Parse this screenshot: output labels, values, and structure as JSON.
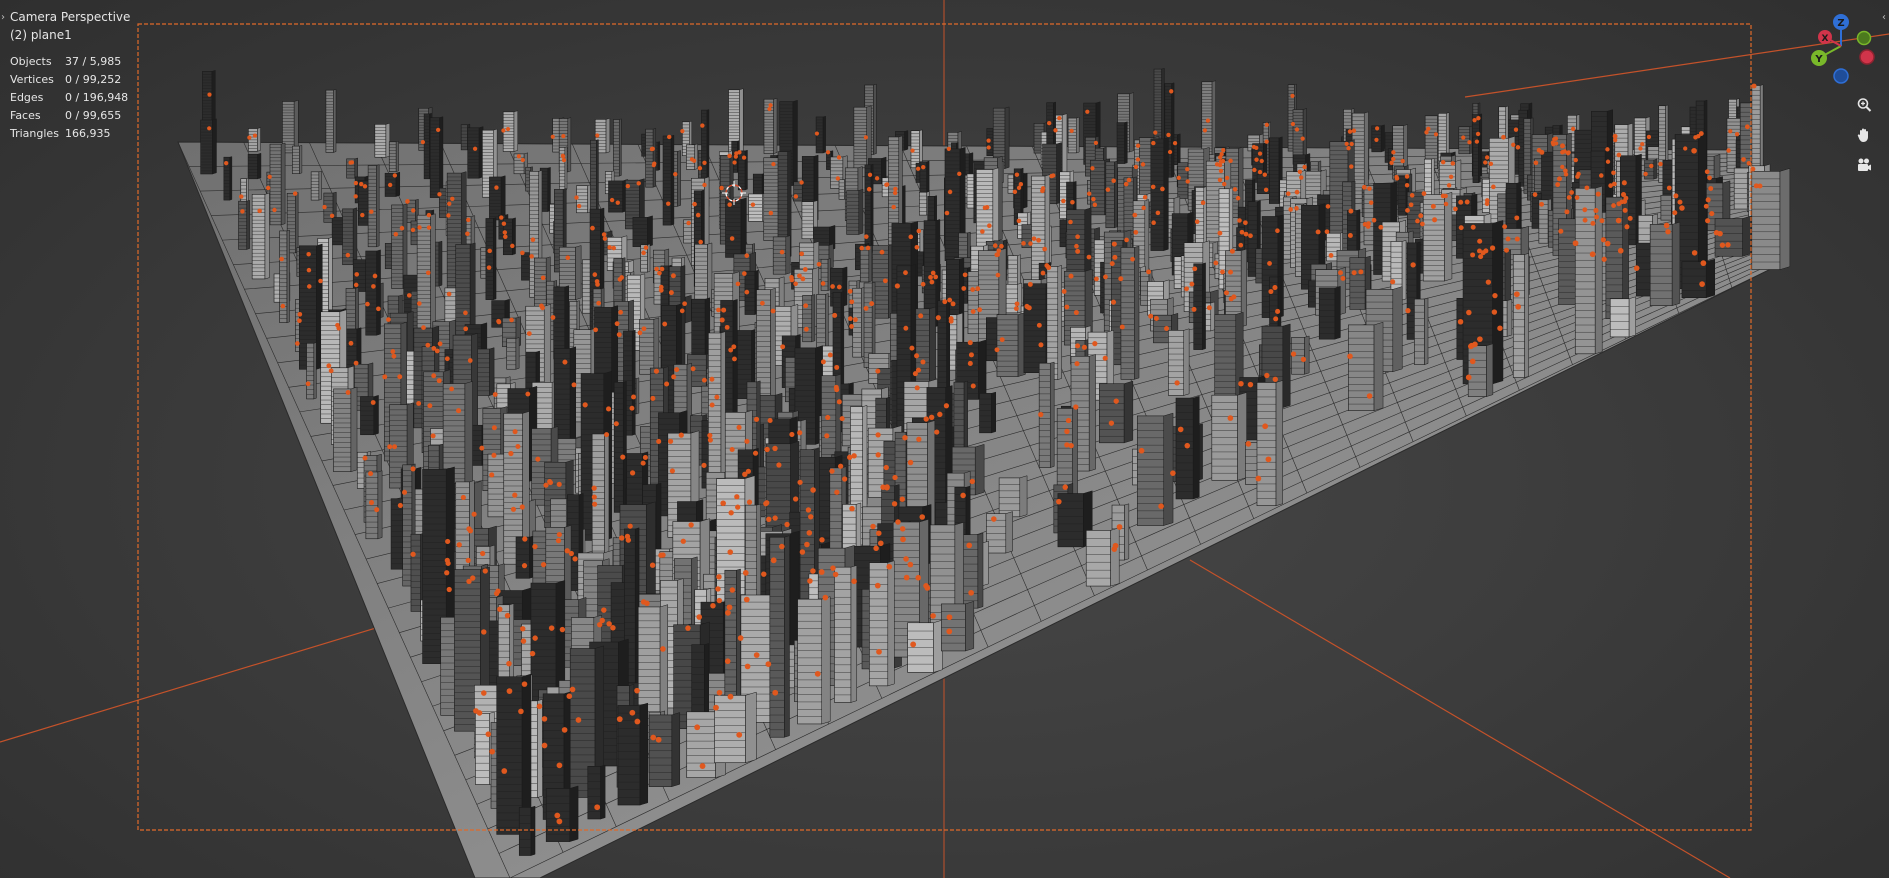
{
  "viewport": {
    "view_name": "Camera Perspective",
    "active_object": "(2) plane1"
  },
  "stats": [
    {
      "label": "Objects",
      "value": "37 / 5,985"
    },
    {
      "label": "Vertices",
      "value": "0 / 99,252"
    },
    {
      "label": "Edges",
      "value": "0 / 196,948"
    },
    {
      "label": "Faces",
      "value": "0 / 99,655"
    },
    {
      "label": "Triangles",
      "value": "166,935"
    }
  ],
  "gizmo": {
    "axes": [
      {
        "label": "Z",
        "color": "#2f6fd6"
      },
      {
        "label": "Y",
        "color": "#79b82a"
      },
      {
        "label": "X",
        "color": "#d1344a"
      }
    ]
  },
  "navigation": {
    "icons": [
      "zoom-icon",
      "pan-hand-icon",
      "camera-view-icon"
    ]
  },
  "colors": {
    "accent_orange": "#e0581e",
    "camera_frame": "#e06a2a",
    "background": "#3d3d3d"
  }
}
